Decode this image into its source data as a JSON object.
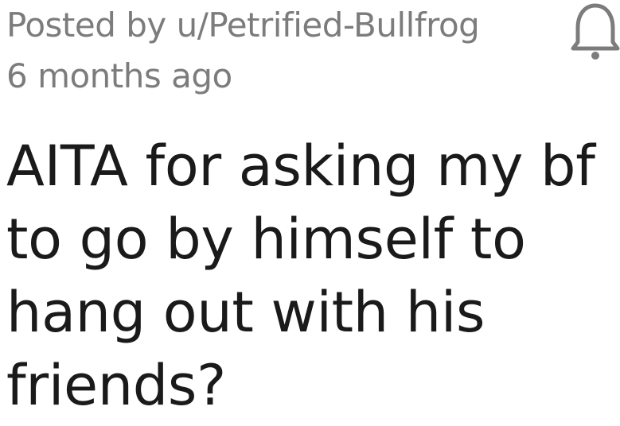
{
  "post": {
    "author_line": "Posted by u/Petrified-Bullfrog",
    "time_ago": "6 months ago",
    "title": "AITA for asking my bf to go by himself to hang out with his friends?"
  },
  "icons": {
    "notification": "bell-icon"
  },
  "colors": {
    "meta_text": "#7c7c7c",
    "title_text": "#1a1a1b",
    "background": "#ffffff"
  }
}
